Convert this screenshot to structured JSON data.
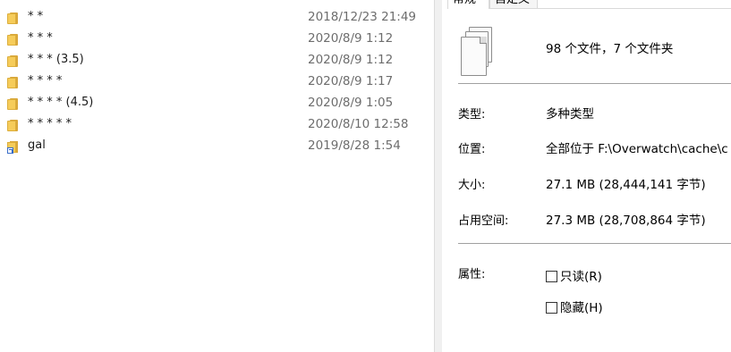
{
  "files": [
    {
      "name": "* *",
      "date": "2018/12/23 21:49",
      "icon": "folder-icon"
    },
    {
      "name": "* * *",
      "date": "2020/8/9 1:12",
      "icon": "folder-icon"
    },
    {
      "name": "* * * (3.5)",
      "date": "2020/8/9 1:12",
      "icon": "folder-icon"
    },
    {
      "name": "* * * *",
      "date": "2020/8/9 1:17",
      "icon": "folder-icon"
    },
    {
      "name": "* * * * (4.5)",
      "date": "2020/8/9 1:05",
      "icon": "folder-icon"
    },
    {
      "name": "* * * * *",
      "date": "2020/8/10 12:58",
      "icon": "folder-icon"
    },
    {
      "name": "gal",
      "date": "2019/8/28 1:54",
      "icon": "shortcut-folder-icon"
    }
  ],
  "properties": {
    "tabs": [
      "常规",
      "自定义"
    ],
    "icon": "multiple-files-icon",
    "summary": "98 个文件，7 个文件夹",
    "rows": [
      {
        "label": "类型:",
        "value": "多种类型"
      },
      {
        "label": "位置:",
        "value": "全部位于 F:\\Overwatch\\cache\\c"
      },
      {
        "label": "大小:",
        "value": "27.1 MB (28,444,141 字节)"
      },
      {
        "label": "占用空间:",
        "value": "27.3 MB (28,708,864 字节)"
      }
    ],
    "attributes_label": "属性:",
    "attributes": [
      {
        "label": "只读(R)",
        "checked": false
      },
      {
        "label": "隐藏(H)",
        "checked": false
      }
    ]
  },
  "colors": {
    "folder": "#f6cc5a",
    "date_text": "#6d6d6d",
    "separator": "#a0a0a0"
  }
}
